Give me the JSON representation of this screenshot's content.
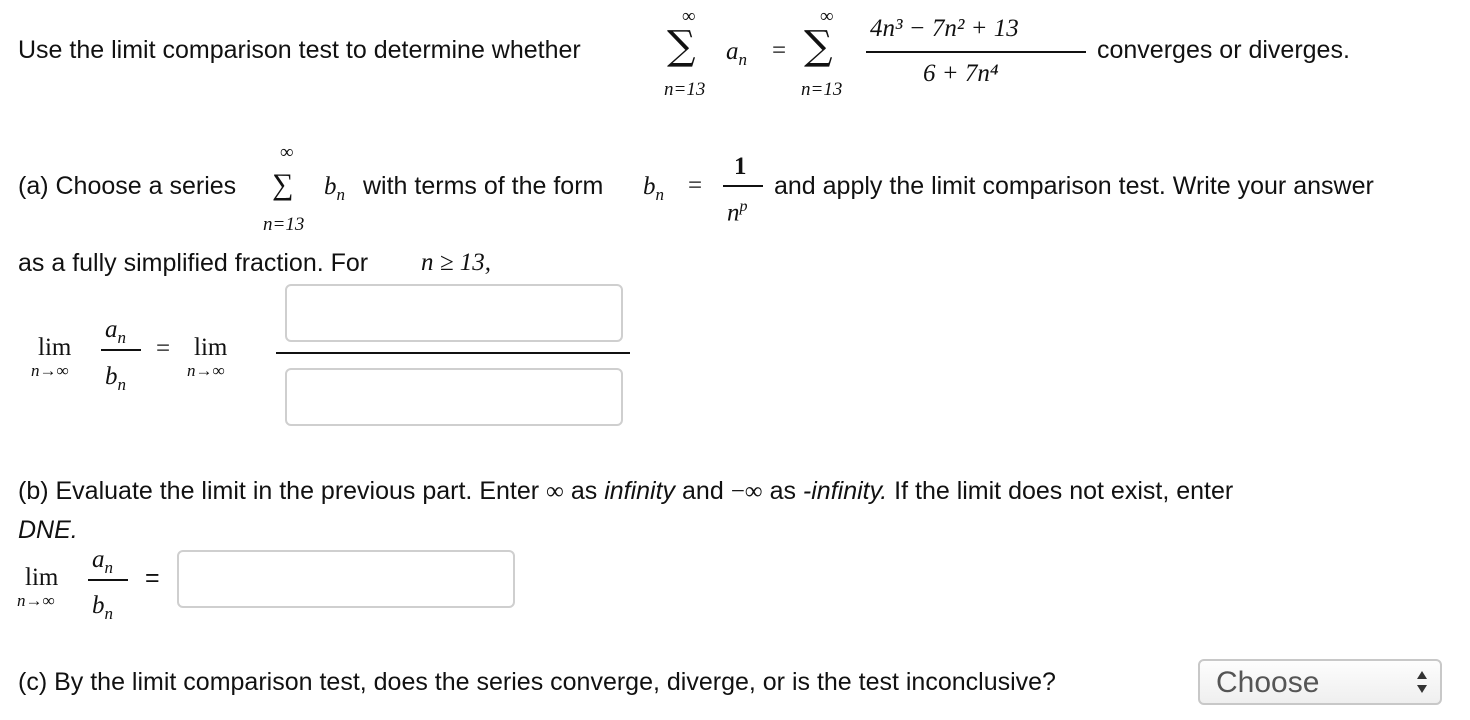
{
  "question": {
    "intro": "Use the limit comparison test to determine whether",
    "sum_upper": "∞",
    "sum_lower": "n=13",
    "term": "a",
    "term_sub": "n",
    "equals": "=",
    "numerator": "4n³ − 7n² + 13",
    "denominator": "6 + 7n⁴",
    "outro": "converges or diverges."
  },
  "part_a": {
    "prefix": "(a) Choose a series",
    "sum_upper": "∞",
    "sum_lower": "n=13",
    "series_term": "b",
    "series_term_sub": "n",
    "mid_text": "with terms of the form",
    "form_lhs": "b",
    "form_lhs_sub": "n",
    "equals": "=",
    "form_num": "1",
    "form_den": "n",
    "form_den_exp": "p",
    "after_text": "and apply the limit comparison test. Write your answer",
    "line2_text": "as a fully simplified fraction. For",
    "condition": "n ≥ 13,",
    "lim_word": "lim",
    "lim_sub": "n→∞",
    "ratio_num": "a",
    "ratio_num_sub": "n",
    "ratio_den": "b",
    "ratio_den_sub": "n",
    "equals2": "=",
    "lim_word2": "lim",
    "lim_sub2": "n→∞",
    "numerator_value": "",
    "denominator_value": ""
  },
  "part_b": {
    "text_start": "(b) Evaluate the limit in the previous part. Enter",
    "infinity_symbol": "∞",
    "text_as": "as",
    "infinity_word": "infinity",
    "text_and": "and",
    "neg_infinity_symbol": "−∞",
    "text_as2": "as",
    "neg_infinity_word": "-infinity.",
    "text_end": "If the limit does not exist, enter",
    "dne": "DNE.",
    "lim_word": "lim",
    "lim_sub": "n→∞",
    "ratio_num": "a",
    "ratio_num_sub": "n",
    "ratio_den": "b",
    "ratio_den_sub": "n",
    "equals": "=",
    "answer_value": ""
  },
  "part_c": {
    "question": "(c) By the limit comparison test, does the series converge, diverge, or is the test inconclusive?",
    "select_value": "Choose"
  }
}
